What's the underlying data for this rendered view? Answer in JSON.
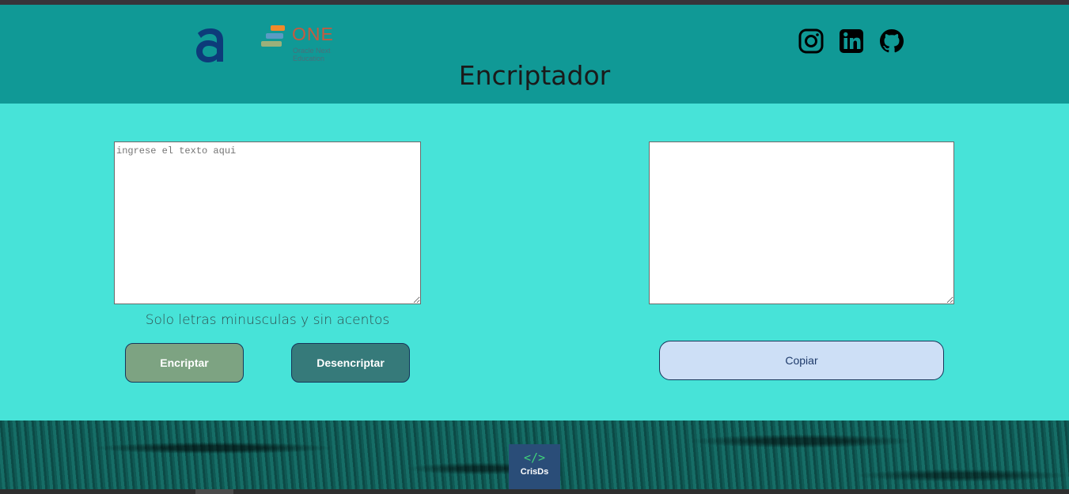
{
  "header": {
    "title": "Encriptador",
    "brand_one": "ONE",
    "brand_one_sub": "Oracle Next Education",
    "social": [
      "instagram-icon",
      "linkedin-icon",
      "github-icon"
    ]
  },
  "input": {
    "placeholder": "ingrese el texto aqui",
    "value": ""
  },
  "output": {
    "value": ""
  },
  "hint": "Solo letras minusculas y sin acentos",
  "buttons": {
    "encrypt": "Encriptar",
    "decrypt": "Desencriptar",
    "copy": "Copiar"
  },
  "footer": {
    "badge_code": "</>",
    "badge_name": "CrisDs"
  },
  "colors": {
    "header_bg": "#109996",
    "main_bg": "#47e3d8",
    "encrypt_btn": "#7da382",
    "decrypt_btn": "#367a7a",
    "copy_btn": "#cddff6"
  }
}
